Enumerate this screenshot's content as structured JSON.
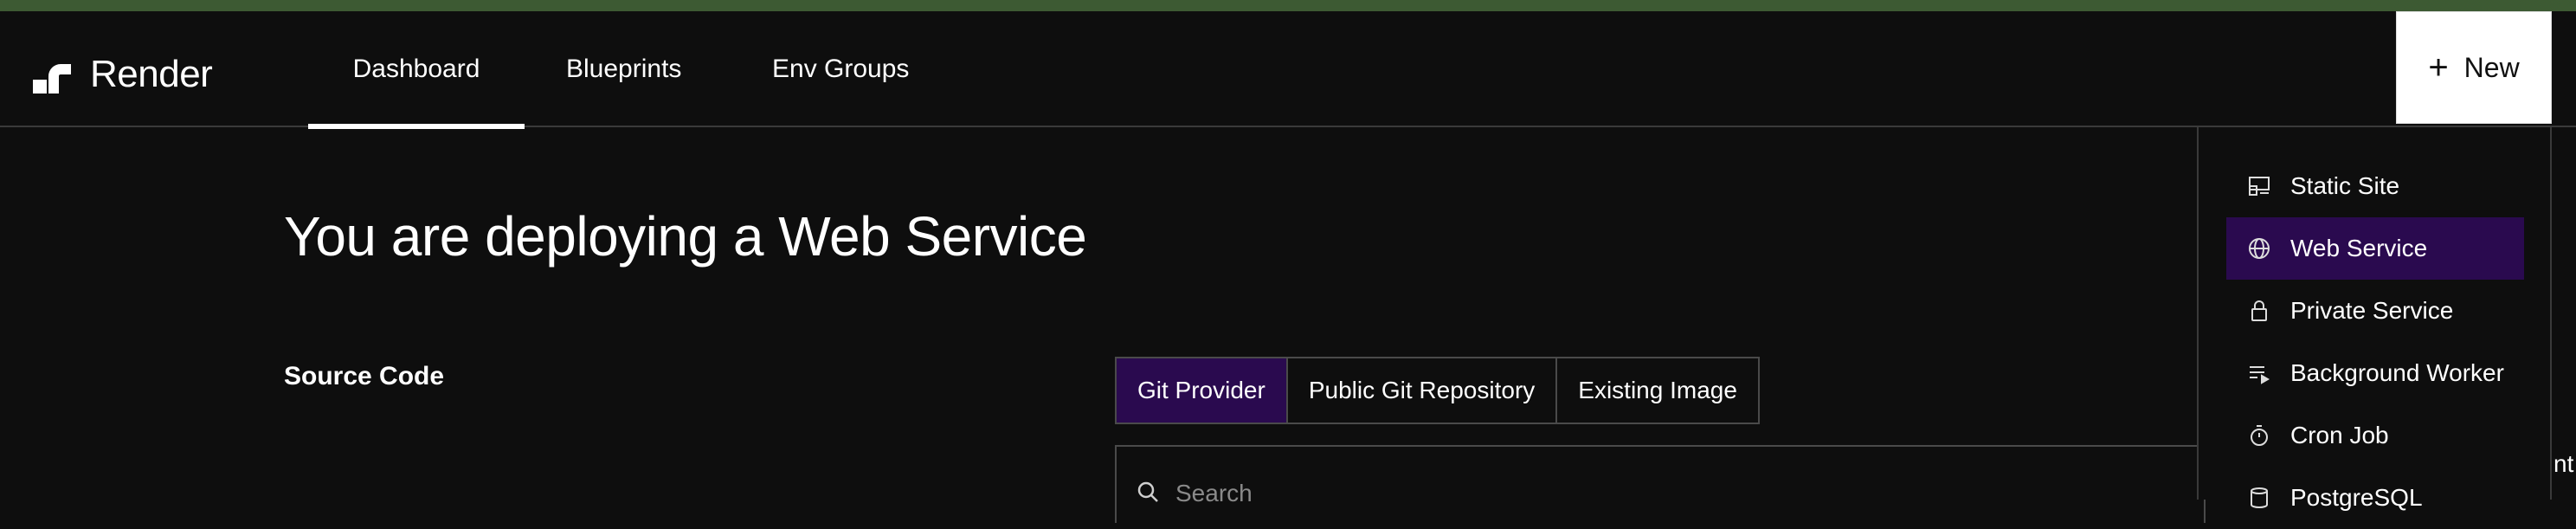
{
  "brand": {
    "name": "Render"
  },
  "nav": {
    "tabs": [
      {
        "label": "Dashboard",
        "active": true
      },
      {
        "label": "Blueprints",
        "active": false
      },
      {
        "label": "Env Groups",
        "active": false
      }
    ],
    "new_button_label": "New"
  },
  "main": {
    "title": "You are deploying a Web Service",
    "source_code_label": "Source Code",
    "source_tabs": [
      {
        "label": "Git Provider",
        "active": true
      },
      {
        "label": "Public Git Repository",
        "active": false
      },
      {
        "label": "Existing Image",
        "active": false
      }
    ],
    "search": {
      "placeholder": "Search",
      "value": ""
    },
    "edge_text": "nt"
  },
  "new_menu": {
    "items": [
      {
        "label": "Static Site",
        "icon": "static-site-icon",
        "active": false
      },
      {
        "label": "Web Service",
        "icon": "globe-icon",
        "active": true
      },
      {
        "label": "Private Service",
        "icon": "lock-icon",
        "active": false
      },
      {
        "label": "Background Worker",
        "icon": "list-play-icon",
        "active": false
      },
      {
        "label": "Cron Job",
        "icon": "stopwatch-icon",
        "active": false
      },
      {
        "label": "PostgreSQL",
        "icon": "database-icon",
        "active": false
      }
    ]
  },
  "colors": {
    "background": "#0e0e0e",
    "top_strip": "#3d5a33",
    "accent_purple": "#2a0a4f",
    "border": "#4a4a4a"
  }
}
